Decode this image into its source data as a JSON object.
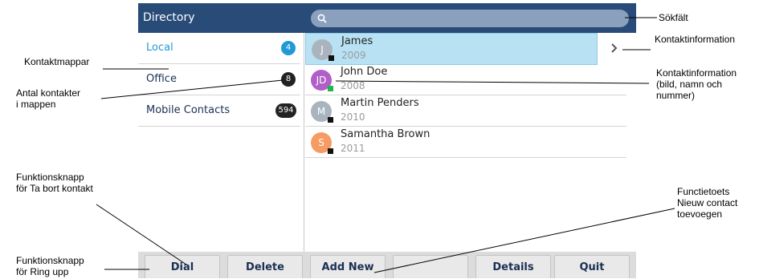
{
  "header": {
    "title": "Directory",
    "search_placeholder": ""
  },
  "folders": [
    {
      "label": "Local",
      "count": "4",
      "selected": true
    },
    {
      "label": "Office",
      "count": "8",
      "selected": false
    },
    {
      "label": "Mobile Contacts",
      "count": "594",
      "selected": false
    }
  ],
  "contacts": [
    {
      "name": "James",
      "number": "2009",
      "initial": "J",
      "avatar_color": "#a9b4bf",
      "presence_color": "#111111",
      "selected": true
    },
    {
      "name": "John Doe",
      "number": "2008",
      "initial": "JD",
      "avatar_color": "#b05fc9",
      "presence_color": "#1fb84a",
      "selected": false
    },
    {
      "name": "Martin Penders",
      "number": "2010",
      "initial": "M",
      "avatar_color": "#a9b4bf",
      "presence_color": "#111111",
      "selected": false
    },
    {
      "name": "Samantha Brown",
      "number": "2011",
      "initial": "S",
      "avatar_color": "#f59b63",
      "presence_color": "#111111",
      "selected": false
    }
  ],
  "softkeys": [
    "Dial",
    "Delete",
    "Add New",
    "",
    "Details",
    "Quit"
  ],
  "annotations": {
    "search_field": "Sökfält",
    "contact_info": "Kontaktinformation",
    "contact_info_detail": "Kontaktinformation\n(bild, namn och\nnummer)",
    "folders": "Kontaktmappar",
    "count": "Antal kontakter\ni mappen",
    "delete_key": "Funktionsknapp\nför Ta bort kontakt",
    "add_key": "Functietoets\nNieuw contact\ntoevoegen",
    "dial_key": "Funktionsknapp\nför Ring upp"
  },
  "colors": {
    "header": "#294b78",
    "accent": "#1f9ad6",
    "selected_row": "#b8e2f4"
  }
}
